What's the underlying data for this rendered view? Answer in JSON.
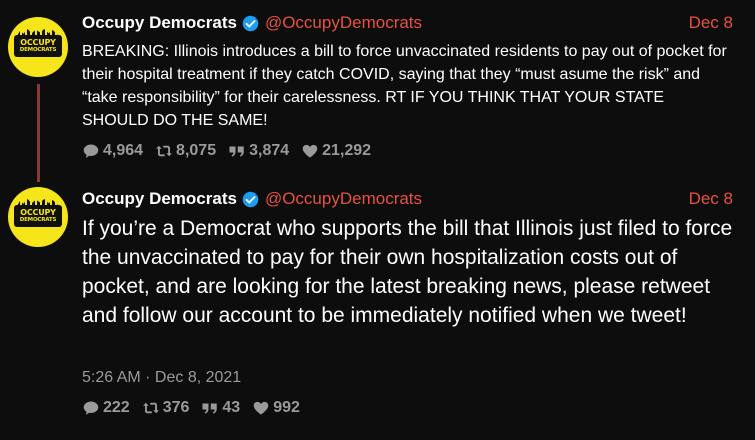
{
  "thread": [
    {
      "author": {
        "display_name": "Occupy Democrats",
        "handle": "@OccupyDemocrats",
        "verified": true,
        "avatar_text_line1": "OCCUPY",
        "avatar_text_line2": "DEMOCRATS"
      },
      "date": "Dec 8",
      "text": "BREAKING: Illinois introduces a bill to force unvaccinated residents to pay out of pocket for their hospital treatment if they catch COVID, saying that they “must asume the risk” and “take responsibility” for their carelessness. RT IF YOU THINK THAT YOUR STATE SHOULD DO THE SAME!",
      "stats": {
        "replies": "4,964",
        "retweets": "8,075",
        "quotes": "3,874",
        "likes": "21,292"
      }
    },
    {
      "author": {
        "display_name": "Occupy Democrats",
        "handle": "@OccupyDemocrats",
        "verified": true,
        "avatar_text_line1": "OCCUPY",
        "avatar_text_line2": "DEMOCRATS"
      },
      "date": "Dec 8",
      "text": "If you’re a Democrat who supports the bill that Illinois just filed to force the unvaccinated to pay for their own hospitalization costs out of pocket, and are looking for the latest breaking news, please retweet and follow our account to be immediately notified when we tweet!",
      "timestamp": "5:26 AM · Dec 8, 2021",
      "stats": {
        "replies": "222",
        "retweets": "376",
        "quotes": "43",
        "likes": "992"
      }
    }
  ],
  "icons": {
    "reply": "speech-bubble-icon",
    "retweet": "retweet-icon",
    "quote": "quote-icon",
    "like": "heart-icon",
    "verified": "verified-badge-icon"
  },
  "colors": {
    "background": "#0d0d0d",
    "accent": "#e8523e",
    "verified": "#1d9bf0",
    "muted": "#9a9a9a",
    "avatar": "#f5e51a",
    "thread_line": "#8a3a34"
  }
}
